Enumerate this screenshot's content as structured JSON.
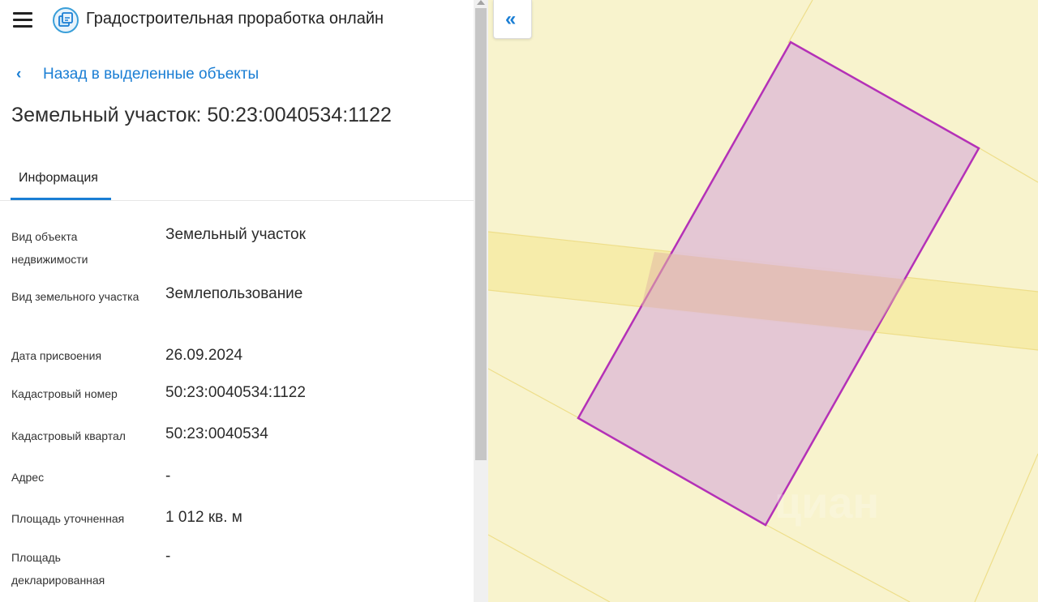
{
  "header": {
    "app_title": "Градостроительная проработка онлайн",
    "menu_icon": "hamburger-menu-icon",
    "logo_icon": "layers-logo-icon"
  },
  "nav": {
    "back_label": "Назад в выделенные объекты",
    "back_icon": "chevron-left-icon"
  },
  "page_title": "Земельный участок: 50:23:0040534:1122",
  "tabs": [
    {
      "label": "Информация",
      "active": true
    }
  ],
  "info": [
    {
      "label": "Вид объекта недвижимости",
      "value": "Земельный участок"
    },
    {
      "label": "Вид земельного участка",
      "value": "Землепользование"
    },
    {
      "label": "Дата присвоения",
      "value": "26.09.2024"
    },
    {
      "label": "Кадастровый номер",
      "value": "50:23:0040534:1122"
    },
    {
      "label": "Кадастровый квартал",
      "value": "50:23:0040534"
    },
    {
      "label": "Адрес",
      "value": "-"
    },
    {
      "label": "Площадь уточненная",
      "value": "1 012 кв. м"
    },
    {
      "label": "Площадь декларированная",
      "value": "-"
    }
  ],
  "map": {
    "collapse_icon": "double-chevron-left-icon",
    "collapse_glyph": "«",
    "watermark": "циан",
    "colors": {
      "background": "#f8f3cd",
      "road": "#f6ecaa",
      "parcel_fill": "#e3c4d4",
      "parcel_border": "#b431b7",
      "accent": "#1a7ed4"
    }
  }
}
